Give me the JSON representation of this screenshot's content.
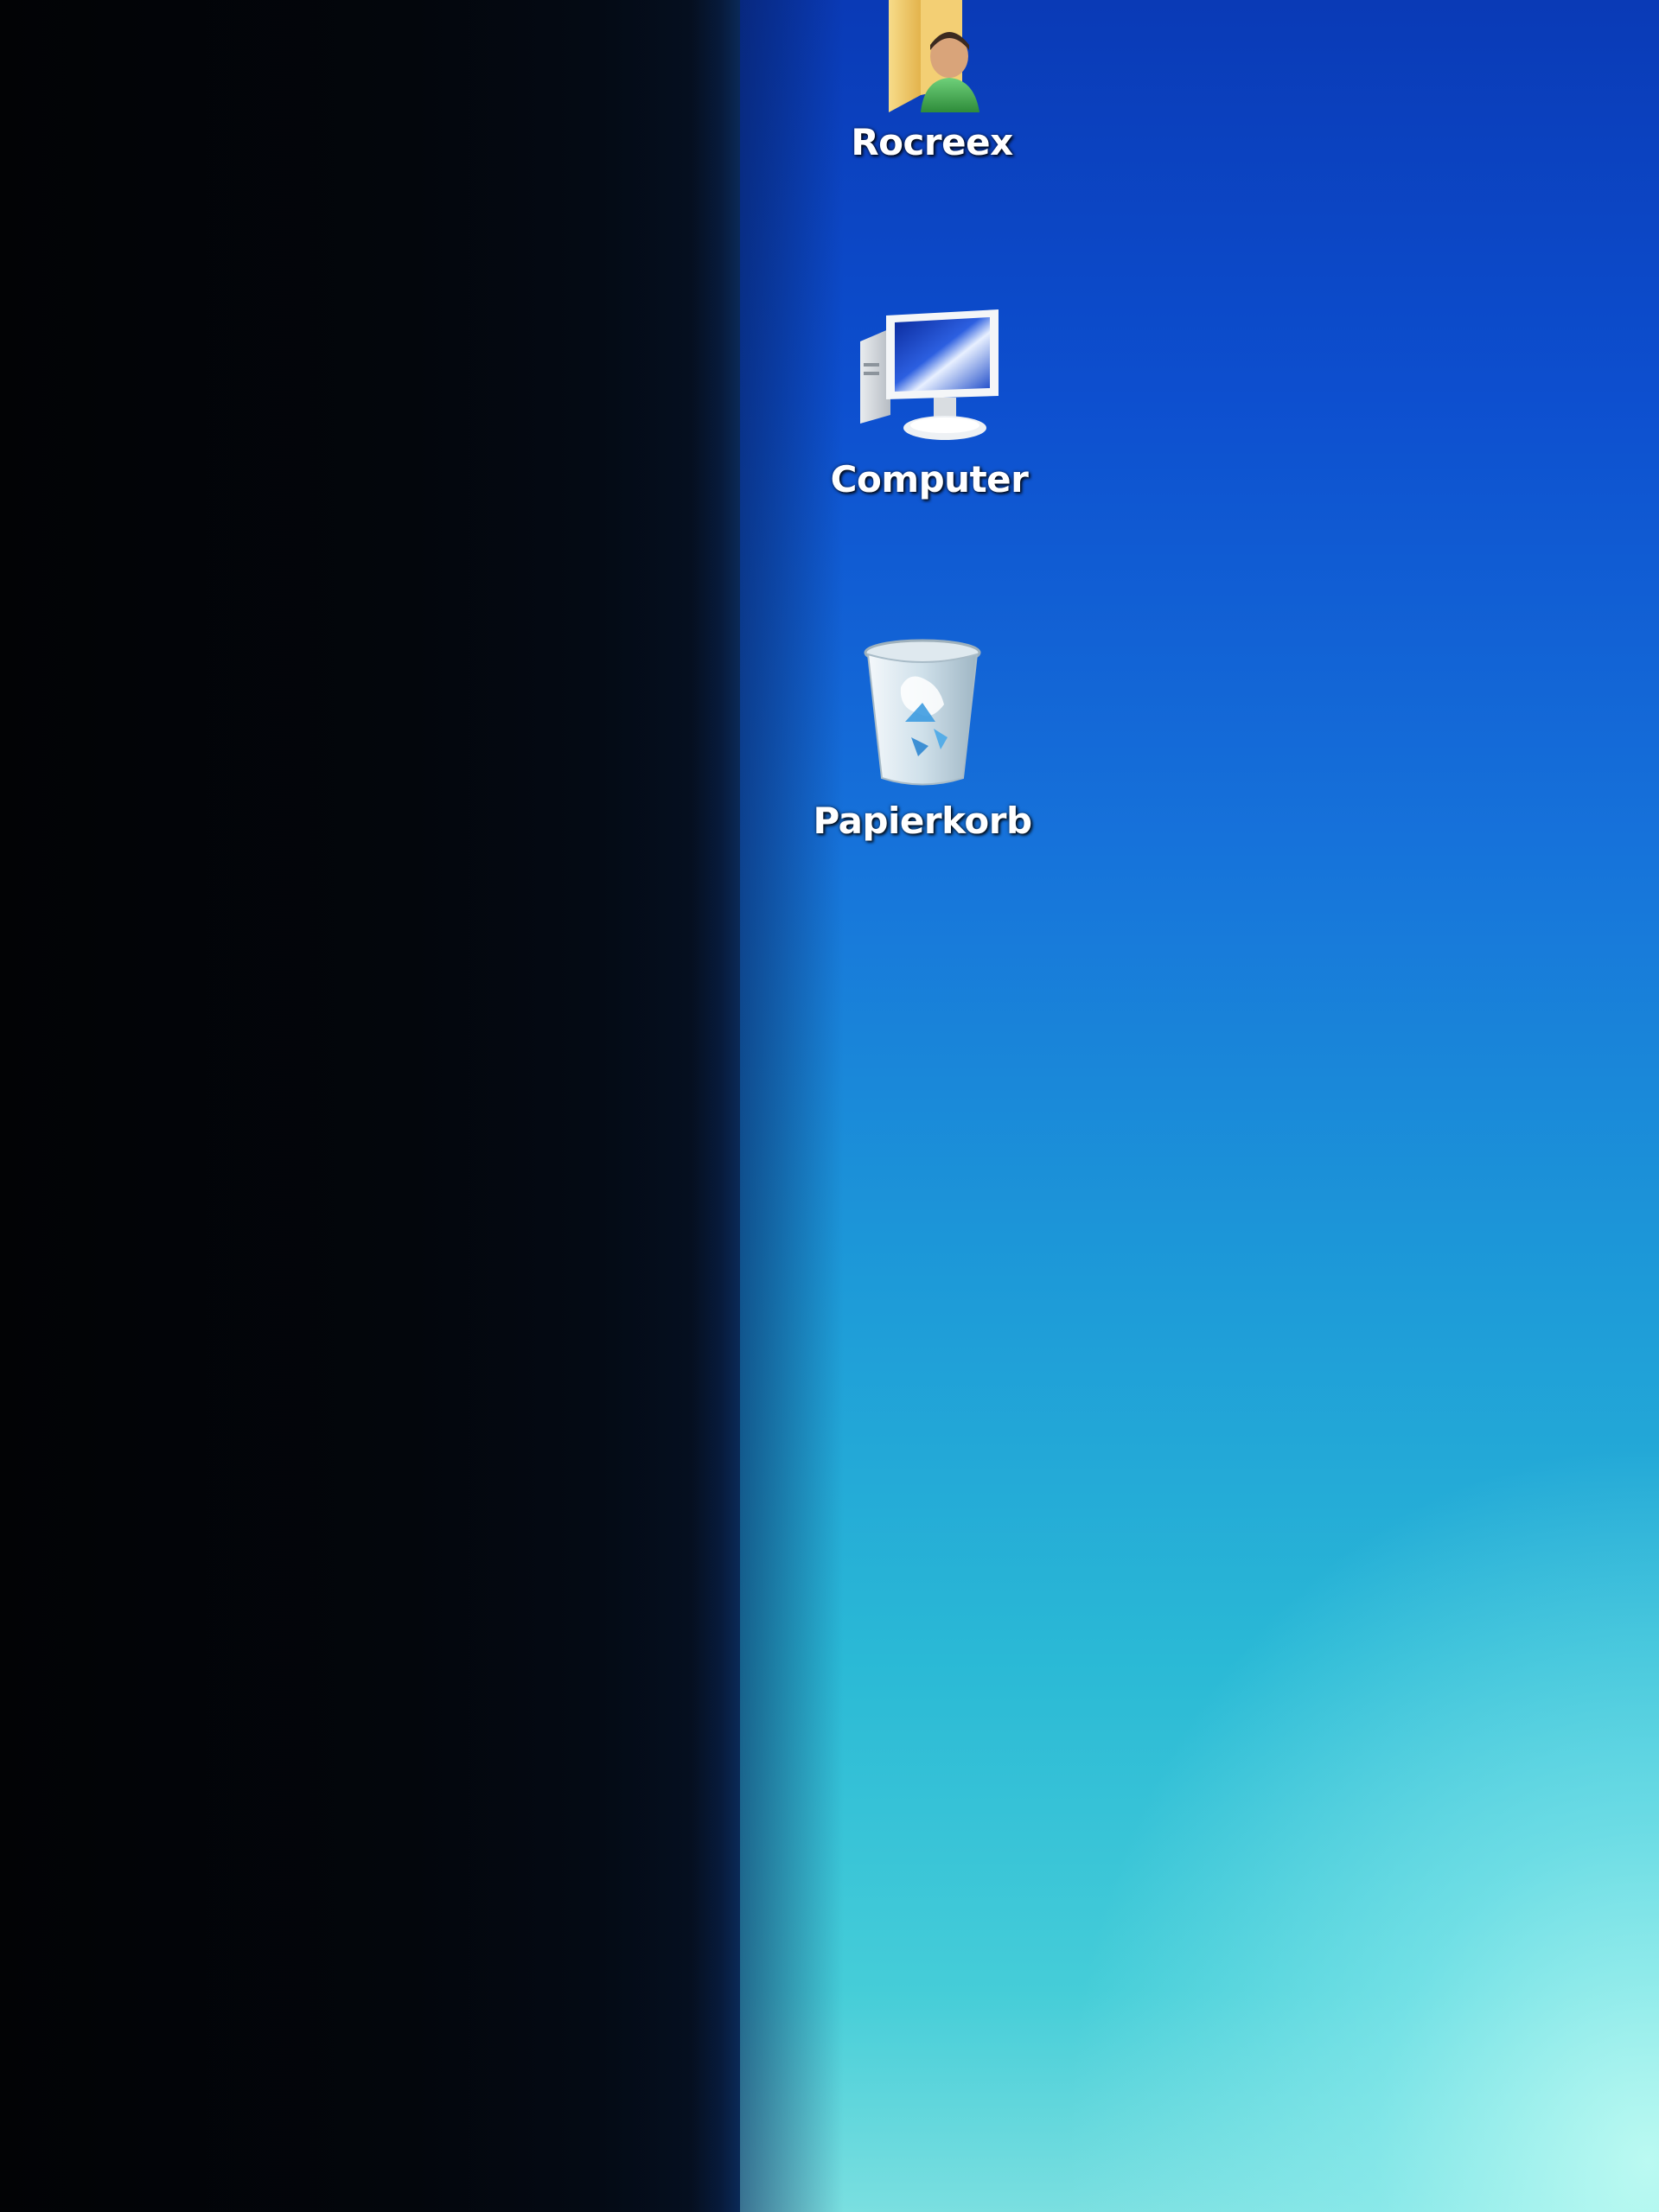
{
  "desktop": {
    "icons": [
      {
        "label": "Rocreex",
        "icon": "user-folder-icon"
      },
      {
        "label": "Computer",
        "icon": "computer-icon"
      },
      {
        "label": "Papierkorb",
        "icon": "recycle-bin-icon"
      }
    ]
  },
  "colors": {
    "desktop_top": "#0a3ab6",
    "desktop_bottom": "#7adfe0",
    "bezel": "#020305"
  }
}
